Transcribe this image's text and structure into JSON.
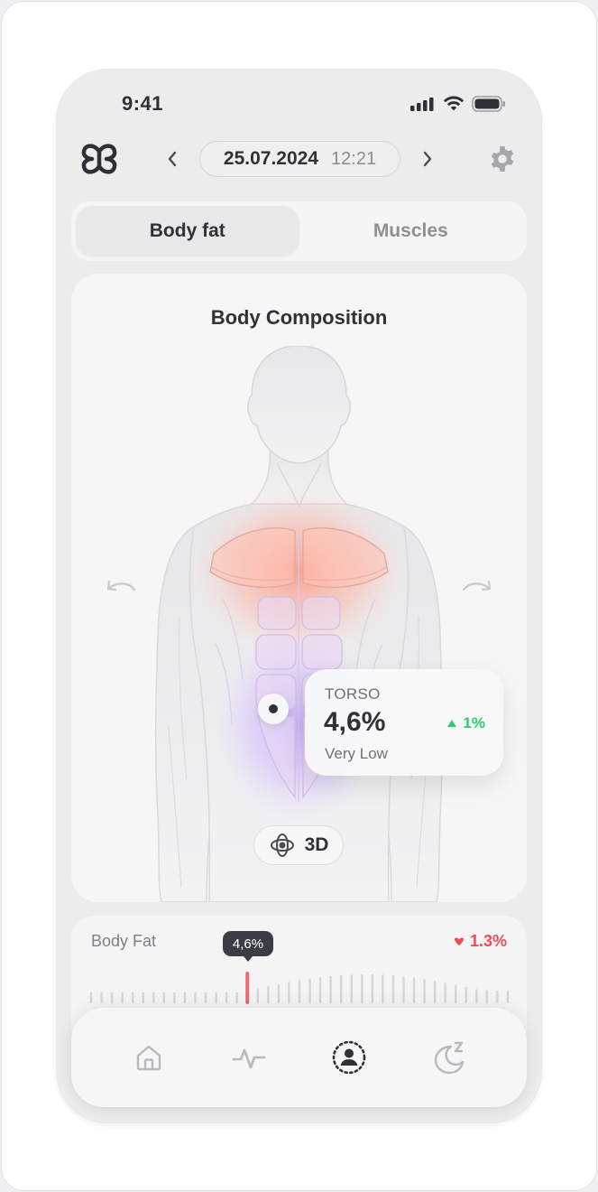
{
  "status_bar": {
    "time": "9:41"
  },
  "header": {
    "date": "25.07.2024",
    "time": "12:21"
  },
  "tabs": [
    {
      "label": "Body fat",
      "active": true
    },
    {
      "label": "Muscles",
      "active": false
    }
  ],
  "composition": {
    "title": "Body Composition",
    "region_label": "TORSO",
    "region_value": "4,6%",
    "region_status": "Very Low",
    "region_change": "1%",
    "region_change_direction": "up",
    "view_button": "3D"
  },
  "body_fat_strip": {
    "title": "Body Fat",
    "current": "4,6%",
    "change": "1.3%",
    "change_direction": "down"
  },
  "colors": {
    "accent_red": "#ee4d55",
    "accent_green": "#2ecc6a",
    "dark": "#2f3136"
  },
  "bottom_nav": [
    {
      "icon": "home-icon"
    },
    {
      "icon": "activity-icon"
    },
    {
      "icon": "body-scan-icon",
      "active": true
    },
    {
      "icon": "sleep-icon"
    }
  ]
}
